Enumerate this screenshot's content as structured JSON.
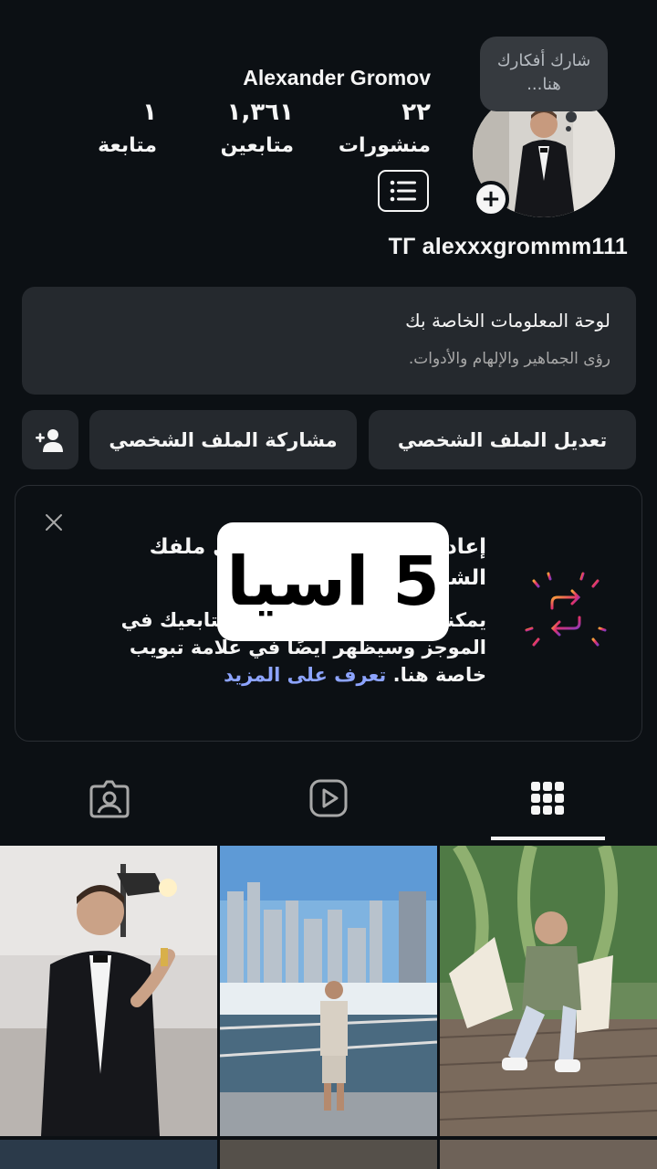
{
  "profile": {
    "full_name": "Alexander Gromov",
    "username": "TГ alexxxgrommm111",
    "note": "شارك أفكارك هنا...",
    "stats": [
      {
        "key": "posts",
        "value": "٢٢",
        "label": "منشورات"
      },
      {
        "key": "followers",
        "value": "١,٣٦١",
        "label": "متابعين"
      },
      {
        "key": "following",
        "value": "١",
        "label": "متابعة"
      }
    ]
  },
  "dashboard": {
    "title": "لوحة المعلومات الخاصة بك",
    "subtitle": "رؤى الجماهير والإلهام والأدوات."
  },
  "buttons": {
    "edit": "تعديل الملف الشخصي",
    "share": "مشاركة الملف الشخصي"
  },
  "promo": {
    "title": "إعادة نشر المنشورات على ملفك الشخصي والمحتوى",
    "body": "يمكنك إعادة نشر المحتوى لمتابعيك في الموجز وسيظهر أيضًا في علامة تبويب خاصة هنا.",
    "link": "تعرف على المزيد"
  },
  "sticker": {
    "text": "5 اسيا"
  },
  "tabs": [
    {
      "key": "grid",
      "icon": "grid-icon",
      "active": true
    },
    {
      "key": "reels",
      "icon": "reels-icon",
      "active": false
    },
    {
      "key": "tagged",
      "icon": "tagged-icon",
      "active": false
    }
  ],
  "colors": {
    "background": "#0c1014",
    "surface": "#25292e",
    "text": "#f5f5f5",
    "muted": "#a8a8a8",
    "link": "#8da4ff"
  }
}
